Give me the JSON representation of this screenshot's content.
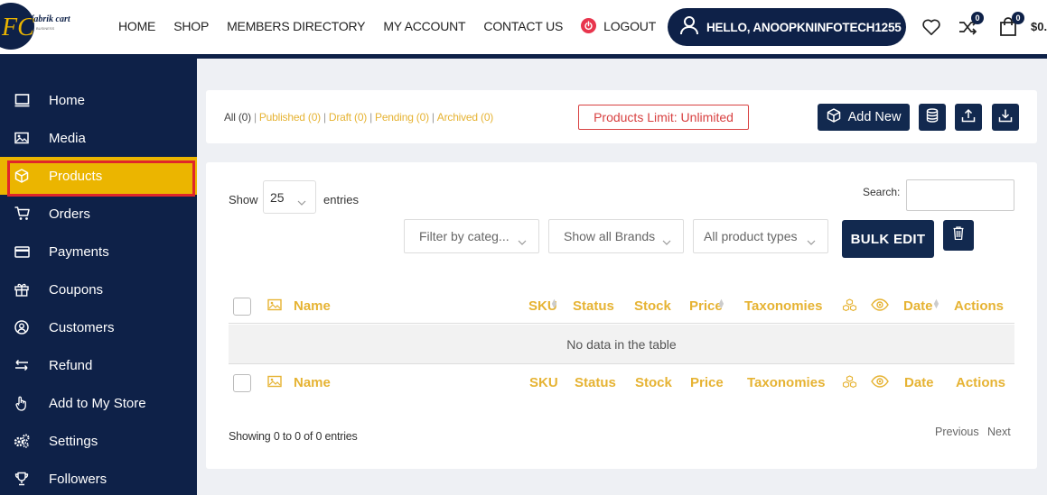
{
  "brand": {
    "logo_letters": "FC",
    "logo_name": "fabrik cart",
    "logo_tagline": "BUSINESS"
  },
  "nav": {
    "items": [
      "HOME",
      "SHOP",
      "MEMBERS DIRECTORY",
      "MY ACCOUNT",
      "CONTACT US"
    ],
    "logout": "LOGOUT"
  },
  "user": {
    "greeting": "HELLO, ANOOPKNINFOTECH1255"
  },
  "header_icons": {
    "compare_count": "0",
    "cart_count": "0",
    "cart_amount": "$0."
  },
  "sidebar": {
    "items": [
      {
        "label": "Home",
        "icon": "monitor-icon"
      },
      {
        "label": "Media",
        "icon": "image-icon"
      },
      {
        "label": "Products",
        "icon": "box-icon",
        "active": true
      },
      {
        "label": "Orders",
        "icon": "cart-icon"
      },
      {
        "label": "Payments",
        "icon": "credit-card-icon"
      },
      {
        "label": "Coupons",
        "icon": "gift-icon"
      },
      {
        "label": "Customers",
        "icon": "user-circle-icon"
      },
      {
        "label": "Refund",
        "icon": "refund-icon"
      },
      {
        "label": "Add to My Store",
        "icon": "hand-pointer-icon"
      },
      {
        "label": "Settings",
        "icon": "gears-icon"
      },
      {
        "label": "Followers",
        "icon": "trophy-icon"
      }
    ]
  },
  "status_filters": {
    "all": "All (0)",
    "published": "Published (0)",
    "draft": "Draft (0)",
    "pending": "Pending (0)",
    "archived": "Archived (0)"
  },
  "products_limit": "Products Limit: Unlimited",
  "actions": {
    "add_new": "Add New"
  },
  "table_controls": {
    "show": "Show",
    "page_size": "25",
    "entries": "entries",
    "search_label": "Search:",
    "filter_category": "Filter by categ...",
    "filter_brand": "Show all Brands",
    "filter_type": "All product types",
    "bulk_edit": "BULK EDIT"
  },
  "table": {
    "columns": {
      "name": "Name",
      "sku": "SKU",
      "status": "Status",
      "stock": "Stock",
      "price": "Price",
      "taxonomies": "Taxonomies",
      "date": "Date",
      "actions": "Actions"
    },
    "empty": "No data in the table",
    "showing": "Showing 0 to 0 of 0 entries",
    "previous": "Previous",
    "next": "Next"
  },
  "colors": {
    "navy": "#0e2148",
    "gold": "#ebb500",
    "link": "#e6b333",
    "danger": "#d84141"
  }
}
